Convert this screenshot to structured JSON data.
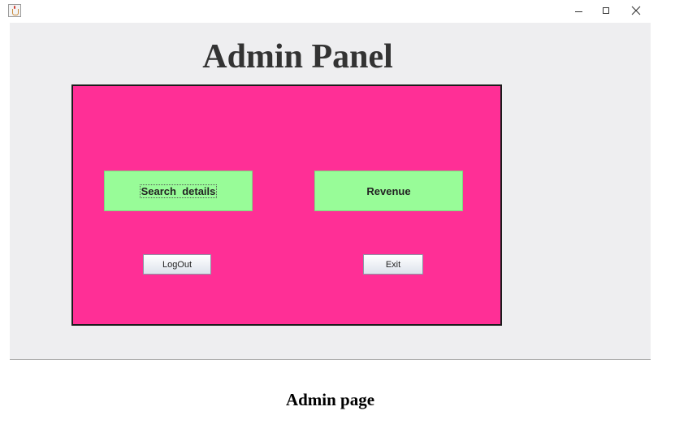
{
  "window": {
    "controls": {
      "minimize_icon": "minimize-icon",
      "maximize_icon": "maximize-icon",
      "close_icon": "close-icon"
    }
  },
  "main": {
    "title": "Admin Panel",
    "panel_color": "#ff2f96",
    "button_color": "#98fc98",
    "buttons": {
      "search_details": "Search  details",
      "revenue": "Revenue",
      "logout": "LogOut",
      "exit": "Exit"
    }
  },
  "caption": "Admin page"
}
